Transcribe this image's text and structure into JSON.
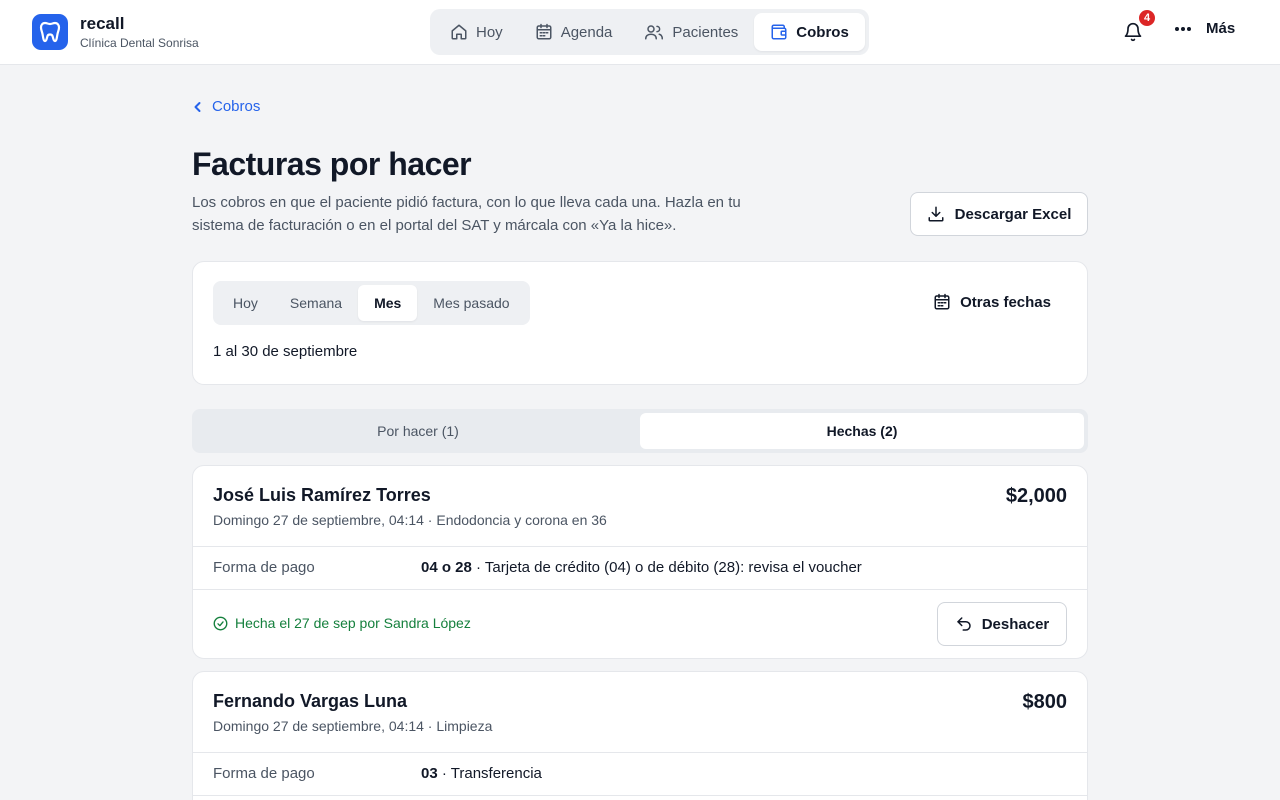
{
  "app": {
    "name": "recall",
    "clinic": "Clínica Dental Sonrisa"
  },
  "nav": {
    "items": [
      {
        "label": "Hoy",
        "icon": "home-icon",
        "active": false
      },
      {
        "label": "Agenda",
        "icon": "calendar-icon",
        "active": false
      },
      {
        "label": "Pacientes",
        "icon": "users-icon",
        "active": false
      },
      {
        "label": "Cobros",
        "icon": "wallet-icon",
        "active": true
      }
    ],
    "notifications": "4",
    "more_label": "Más"
  },
  "page": {
    "back_label": "Cobros",
    "title": "Facturas por hacer",
    "description": "Los cobros en que el paciente pidió factura, con lo que lleva cada una. Hazla en tu sistema de facturación o en el portal del SAT y márcala con «Ya la hice».",
    "download_label": "Descargar Excel"
  },
  "filters": {
    "periods": [
      "Hoy",
      "Semana",
      "Mes",
      "Mes pasado"
    ],
    "active_period": "Mes",
    "other_dates_label": "Otras fechas",
    "range": "1 al 30 de septiembre"
  },
  "tabs": {
    "pending": "Por hacer (1)",
    "done": "Hechas (2)",
    "active": "done"
  },
  "invoices": [
    {
      "patient": "José Luis Ramírez Torres",
      "meta": "Domingo 27 de septiembre, 04:14 · Endodoncia y corona en 36",
      "amount": "$2,000",
      "payment_label": "Forma de pago",
      "payment_code": "04 o 28",
      "payment_desc": " · Tarjeta de crédito (04) o de débito (28): revisa el voucher",
      "done_text": "Hecha el 27 de sep por Sandra López",
      "undo_label": "Deshacer"
    },
    {
      "patient": "Fernando Vargas Luna",
      "meta": "Domingo 27 de septiembre, 04:14 · Limpieza",
      "amount": "$800",
      "payment_label": "Forma de pago",
      "payment_code": "03",
      "payment_desc": " · Transferencia"
    }
  ],
  "colors": {
    "accent": "#2563eb",
    "success": "#15803d",
    "badge": "#dc2626"
  }
}
